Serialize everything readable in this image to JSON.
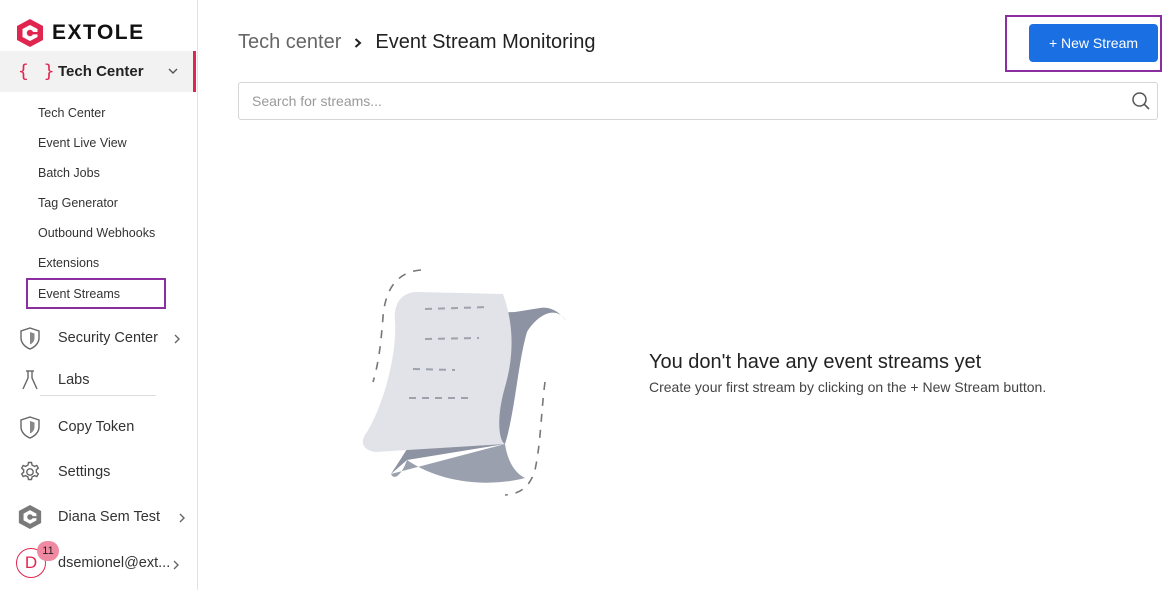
{
  "brand": {
    "name": "EXTOLE",
    "accent": "#e0264f"
  },
  "sidebar": {
    "tech_center": {
      "icon": "braces-icon",
      "label": "Tech Center"
    },
    "sub_items": [
      {
        "label": "Tech Center"
      },
      {
        "label": "Event Live View"
      },
      {
        "label": "Batch Jobs"
      },
      {
        "label": "Tag Generator"
      },
      {
        "label": "Outbound Webhooks"
      },
      {
        "label": "Extensions"
      },
      {
        "label": "Event Streams",
        "active": true
      }
    ],
    "items": [
      {
        "icon": "shield-icon",
        "label": "Security Center"
      },
      {
        "icon": "flask-icon",
        "label": "Labs"
      },
      {
        "icon": "shield-icon",
        "label": "Copy Token"
      },
      {
        "icon": "gear-icon",
        "label": "Settings"
      },
      {
        "icon": "extole-logo-icon",
        "label": "Diana Sem Test"
      },
      {
        "icon": "avatar",
        "label": "dsemionel@ext..."
      }
    ],
    "user": {
      "initial": "D",
      "notification_count": "11"
    }
  },
  "header": {
    "breadcrumb_parent": "Tech center",
    "breadcrumb_current": "Event Stream Monitoring",
    "new_stream_label": "+ New Stream"
  },
  "search": {
    "placeholder": "Search for streams...",
    "value": ""
  },
  "empty_state": {
    "title": "You don't have any event streams yet",
    "subtitle": "Create your first stream by clicking on the + New Stream button."
  },
  "colors": {
    "primary_button": "#1a6fe3",
    "highlight": "#8b2fa0"
  }
}
